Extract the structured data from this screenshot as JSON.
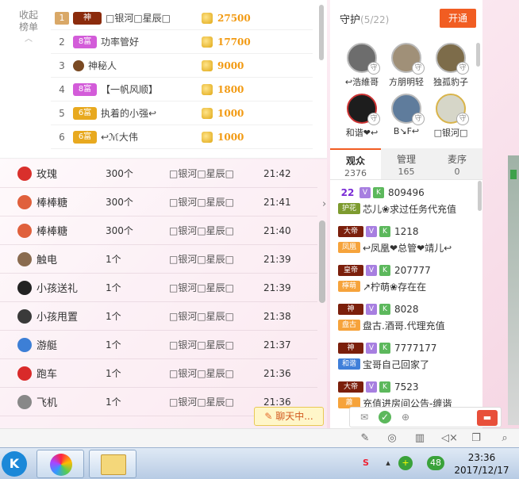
{
  "rank": {
    "collapse_label": "收起\n榜单",
    "rows": [
      {
        "num": "1",
        "badge": "神",
        "name": "□银河□星辰□",
        "score": "27500"
      },
      {
        "num": "2",
        "badge": "8富",
        "name": "功率管好",
        "score": "17700"
      },
      {
        "num": "3",
        "badge": "",
        "name": "神秘人",
        "score": "9000"
      },
      {
        "num": "4",
        "badge": "8富",
        "name": "【一帆风顺】",
        "score": "1800"
      },
      {
        "num": "5",
        "badge": "6富",
        "name": "执着的小强↩",
        "score": "1000"
      },
      {
        "num": "6",
        "badge": "6富",
        "name": "↩ℳ大伟",
        "score": "1000"
      }
    ]
  },
  "gifts": [
    {
      "name": "玫瑰",
      "count": "300个",
      "user": "□银河□星辰□",
      "time": "21:42",
      "color": "#d9302c"
    },
    {
      "name": "棒棒糖",
      "count": "300个",
      "user": "□银河□星辰□",
      "time": "21:41",
      "color": "#e0603c"
    },
    {
      "name": "棒棒糖",
      "count": "300个",
      "user": "□银河□星辰□",
      "time": "21:40",
      "color": "#e0603c"
    },
    {
      "name": "触电",
      "count": "1个",
      "user": "□银河□星辰□",
      "time": "21:39",
      "color": "#8a6b4f"
    },
    {
      "name": "小孩送礼",
      "count": "1个",
      "user": "□银河□星辰□",
      "time": "21:39",
      "color": "#222222"
    },
    {
      "name": "小孩甩置",
      "count": "1个",
      "user": "□银河□星辰□",
      "time": "21:38",
      "color": "#3a3a3a"
    },
    {
      "name": "游艇",
      "count": "1个",
      "user": "□银河□星辰□",
      "time": "21:37",
      "color": "#3d7fd6"
    },
    {
      "name": "跑车",
      "count": "1个",
      "user": "□银河□星辰□",
      "time": "21:36",
      "color": "#d92a2a"
    },
    {
      "name": "飞机",
      "count": "1个",
      "user": "□银河□星辰□",
      "time": "21:36",
      "color": "#888888"
    }
  ],
  "chat_bubble": "聊天中...",
  "guard": {
    "title": "守护",
    "count": "(5/22)",
    "open_label": "开通",
    "members": [
      {
        "name": "↩浩維哥"
      },
      {
        "name": "方朋明轻"
      },
      {
        "name": "独孤豹子"
      },
      {
        "name": "和谐❤↩"
      },
      {
        "name": "B↘F↩"
      },
      {
        "name": "□银河□"
      }
    ]
  },
  "tabs": [
    {
      "label": "观众",
      "count": "2376"
    },
    {
      "label": "管理",
      "count": "165"
    },
    {
      "label": "麦序",
      "count": "0"
    }
  ],
  "audience": [
    {
      "level": "22",
      "v": "V",
      "k": "K",
      "id": "809496",
      "tag": "护花",
      "msg": "芯儿❀求过任务代充值"
    },
    {
      "level": "大帝",
      "v": "V",
      "k": "K",
      "id": "1218",
      "tag": "凤凰",
      "msg": "↩凤凰❤总管❤靖儿↩"
    },
    {
      "level": "皇帝",
      "v": "V",
      "k": "K",
      "id": "207777",
      "tag": "檸萌",
      "msg": "↗柠萌❀存在在"
    },
    {
      "level": "神",
      "v": "V",
      "k": "K",
      "id": "8028",
      "tag": "盘古",
      "msg": "盘古.酒哥.代理充值"
    },
    {
      "level": "神",
      "v": "V",
      "k": "K",
      "id": "7777177",
      "tag": "和谐",
      "msg": "宝哥自己回家了"
    },
    {
      "level": "大帝",
      "v": "V",
      "k": "K",
      "id": "7523",
      "tag": "蕭",
      "msg": "充值进房间公告-缠谐"
    }
  ],
  "taskbar": {
    "time": "23:36",
    "date": "2017/12/17",
    "tray_badge": "48"
  },
  "colors": {
    "accent": "#f15d22",
    "gold": "#f29a12"
  }
}
